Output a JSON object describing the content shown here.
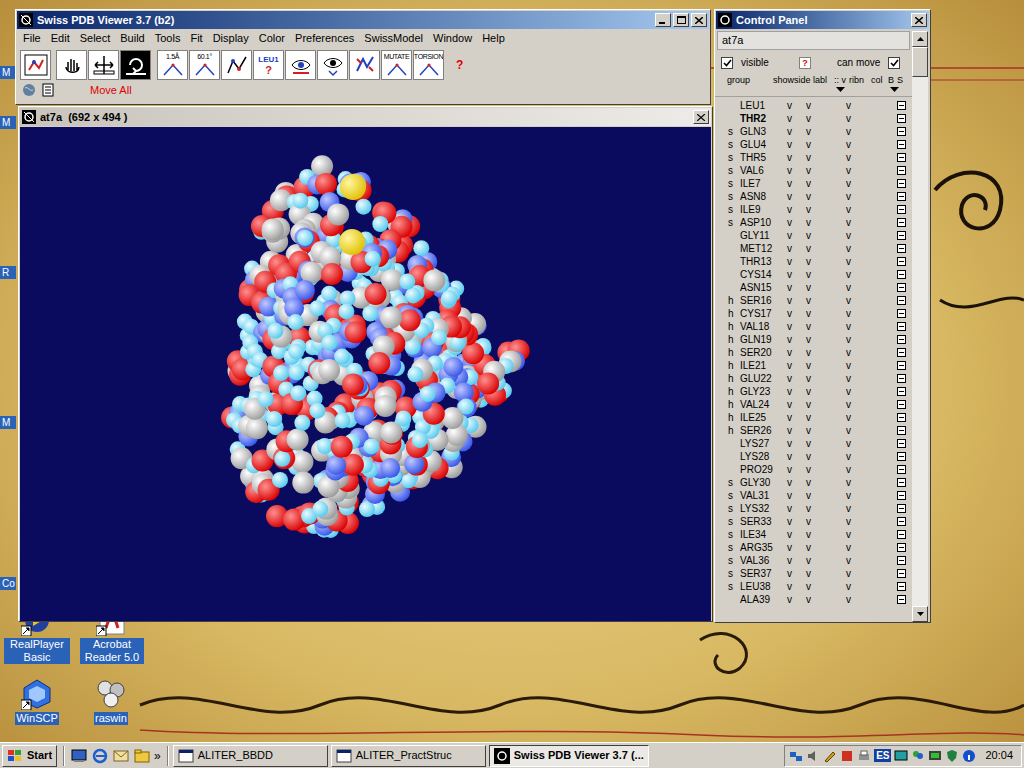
{
  "desktop": {
    "edge_labels": [
      "M",
      "M",
      "R",
      "M",
      "Co"
    ],
    "icons": [
      {
        "label": "RealPlayer Basic"
      },
      {
        "label": "Acrobat Reader 5.0"
      },
      {
        "label": "WinSCP"
      },
      {
        "label": "raswin"
      }
    ]
  },
  "main_window": {
    "title": "Swiss PDB Viewer 3.7 (b2)",
    "menu": [
      "File",
      "Edit",
      "Select",
      "Build",
      "Tools",
      "Fit",
      "Display",
      "Color",
      "Preferences",
      "SwissModel",
      "Window",
      "Help"
    ],
    "modes": [
      {
        "selected": false
      },
      {
        "selected": false
      },
      {
        "selected": true
      }
    ],
    "tools": [
      {
        "kind": "text",
        "label": "1.5Å"
      },
      {
        "kind": "text",
        "label": "60.1°"
      },
      {
        "kind": "icon"
      },
      {
        "kind": "text2",
        "label": "LEU1",
        "sub": "?"
      },
      {
        "kind": "icon"
      },
      {
        "kind": "icon"
      },
      {
        "kind": "icon"
      },
      {
        "kind": "text",
        "label": "MUTATE"
      },
      {
        "kind": "text",
        "label": "TORSION"
      }
    ],
    "help": "?",
    "status": "Move All"
  },
  "structure_window": {
    "title": "at7a  (692 x 494 )"
  },
  "control_panel": {
    "title": "Control Panel",
    "model": "at7a",
    "visible": {
      "label": "visible",
      "checked": true
    },
    "help": "?",
    "can_move": {
      "label": "can move",
      "checked": true
    },
    "headers": [
      "group",
      "show",
      "side",
      "labl",
      ":: v",
      "ribn",
      "col",
      "B",
      "S"
    ],
    "rows": [
      {
        "ss": "",
        "name": "LEU1",
        "selected": false,
        "show": "v",
        "side": "v",
        "ribn": "v"
      },
      {
        "ss": "",
        "name": "THR2",
        "selected": true,
        "show": "v",
        "side": "v",
        "ribn": "v"
      },
      {
        "ss": "s",
        "name": "GLN3",
        "selected": false,
        "show": "v",
        "side": "v",
        "ribn": "v"
      },
      {
        "ss": "s",
        "name": "GLU4",
        "selected": false,
        "show": "v",
        "side": "v",
        "ribn": "v"
      },
      {
        "ss": "s",
        "name": "THR5",
        "selected": false,
        "show": "v",
        "side": "v",
        "ribn": "v"
      },
      {
        "ss": "s",
        "name": "VAL6",
        "selected": false,
        "show": "v",
        "side": "v",
        "ribn": "v"
      },
      {
        "ss": "s",
        "name": "ILE7",
        "selected": false,
        "show": "v",
        "side": "v",
        "ribn": "v"
      },
      {
        "ss": "s",
        "name": "ASN8",
        "selected": false,
        "show": "v",
        "side": "v",
        "ribn": "v"
      },
      {
        "ss": "s",
        "name": "ILE9",
        "selected": false,
        "show": "v",
        "side": "v",
        "ribn": "v"
      },
      {
        "ss": "s",
        "name": "ASP10",
        "selected": false,
        "show": "v",
        "side": "v",
        "ribn": "v"
      },
      {
        "ss": "",
        "name": "GLY11",
        "selected": false,
        "show": "v",
        "side": "v",
        "ribn": "v"
      },
      {
        "ss": "",
        "name": "MET12",
        "selected": false,
        "show": "v",
        "side": "v",
        "ribn": "v"
      },
      {
        "ss": "",
        "name": "THR13",
        "selected": false,
        "show": "v",
        "side": "v",
        "ribn": "v"
      },
      {
        "ss": "",
        "name": "CYS14",
        "selected": false,
        "show": "v",
        "side": "v",
        "ribn": "v"
      },
      {
        "ss": "",
        "name": "ASN15",
        "selected": false,
        "show": "v",
        "side": "v",
        "ribn": "v"
      },
      {
        "ss": "h",
        "name": "SER16",
        "selected": false,
        "show": "v",
        "side": "v",
        "ribn": "v"
      },
      {
        "ss": "h",
        "name": "CYS17",
        "selected": false,
        "show": "v",
        "side": "v",
        "ribn": "v"
      },
      {
        "ss": "h",
        "name": "VAL18",
        "selected": false,
        "show": "v",
        "side": "v",
        "ribn": "v"
      },
      {
        "ss": "h",
        "name": "GLN19",
        "selected": false,
        "show": "v",
        "side": "v",
        "ribn": "v"
      },
      {
        "ss": "h",
        "name": "SER20",
        "selected": false,
        "show": "v",
        "side": "v",
        "ribn": "v"
      },
      {
        "ss": "h",
        "name": "ILE21",
        "selected": false,
        "show": "v",
        "side": "v",
        "ribn": "v"
      },
      {
        "ss": "h",
        "name": "GLU22",
        "selected": false,
        "show": "v",
        "side": "v",
        "ribn": "v"
      },
      {
        "ss": "h",
        "name": "GLY23",
        "selected": false,
        "show": "v",
        "side": "v",
        "ribn": "v"
      },
      {
        "ss": "h",
        "name": "VAL24",
        "selected": false,
        "show": "v",
        "side": "v",
        "ribn": "v"
      },
      {
        "ss": "h",
        "name": "ILE25",
        "selected": false,
        "show": "v",
        "side": "v",
        "ribn": "v"
      },
      {
        "ss": "h",
        "name": "SER26",
        "selected": false,
        "show": "v",
        "side": "v",
        "ribn": "v"
      },
      {
        "ss": "",
        "name": "LYS27",
        "selected": false,
        "show": "v",
        "side": "v",
        "ribn": "v"
      },
      {
        "ss": "",
        "name": "LYS28",
        "selected": false,
        "show": "v",
        "side": "v",
        "ribn": "v"
      },
      {
        "ss": "",
        "name": "PRO29",
        "selected": false,
        "show": "v",
        "side": "v",
        "ribn": "v"
      },
      {
        "ss": "s",
        "name": "GLY30",
        "selected": false,
        "show": "v",
        "side": "v",
        "ribn": "v"
      },
      {
        "ss": "s",
        "name": "VAL31",
        "selected": false,
        "show": "v",
        "side": "v",
        "ribn": "v"
      },
      {
        "ss": "s",
        "name": "LYS32",
        "selected": false,
        "show": "v",
        "side": "v",
        "ribn": "v"
      },
      {
        "ss": "s",
        "name": "SER33",
        "selected": false,
        "show": "v",
        "side": "v",
        "ribn": "v"
      },
      {
        "ss": "s",
        "name": "ILE34",
        "selected": false,
        "show": "v",
        "side": "v",
        "ribn": "v"
      },
      {
        "ss": "s",
        "name": "ARG35",
        "selected": false,
        "show": "v",
        "side": "v",
        "ribn": "v"
      },
      {
        "ss": "s",
        "name": "VAL36",
        "selected": false,
        "show": "v",
        "side": "v",
        "ribn": "v"
      },
      {
        "ss": "s",
        "name": "SER37",
        "selected": false,
        "show": "v",
        "side": "v",
        "ribn": "v"
      },
      {
        "ss": "s",
        "name": "LEU38",
        "selected": false,
        "show": "v",
        "side": "v",
        "ribn": "v"
      },
      {
        "ss": "",
        "name": "ALA39",
        "selected": false,
        "show": "v",
        "side": "v",
        "ribn": "v"
      }
    ]
  },
  "taskbar": {
    "start": "Start",
    "more": "»",
    "tasks": [
      {
        "label": "ALITER_BBDD",
        "selected": false
      },
      {
        "label": "ALITER_PractStruc",
        "selected": false
      },
      {
        "label": "Swiss PDB Viewer 3.7 (...",
        "selected": true
      }
    ],
    "language": "ES",
    "clock": "20:04"
  }
}
